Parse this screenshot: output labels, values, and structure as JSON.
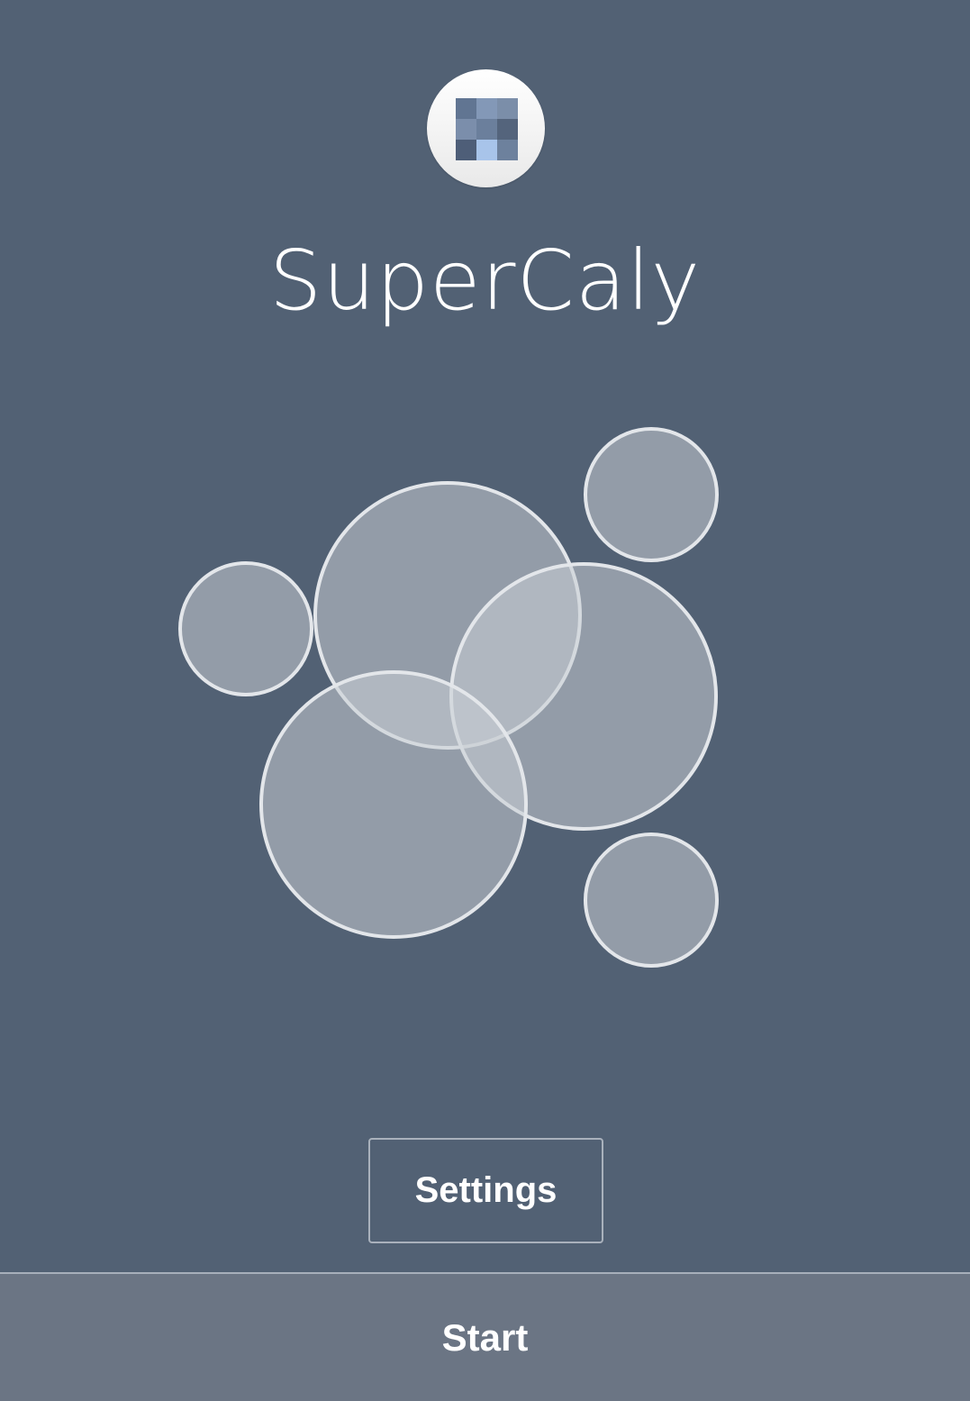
{
  "app": {
    "title": "SuperCaly",
    "logo_icon": "supercaly-logo-icon",
    "logo_colors": [
      "#617592",
      "#8398b7",
      "#7b8ea9",
      "#7b8eab",
      "#6b7f9c",
      "#54647c",
      "#4e5e78",
      "#a8c4ea",
      "#6d819d"
    ]
  },
  "illustration": {
    "icon": "bubbles-illustration",
    "fill_color": "#c8cdd4",
    "stroke_color": "#e3e6ea"
  },
  "actions": {
    "settings_label": "Settings",
    "start_label": "Start"
  },
  "colors": {
    "background": "#526174",
    "start_bar": "#6b7584",
    "text": "#ffffff"
  }
}
